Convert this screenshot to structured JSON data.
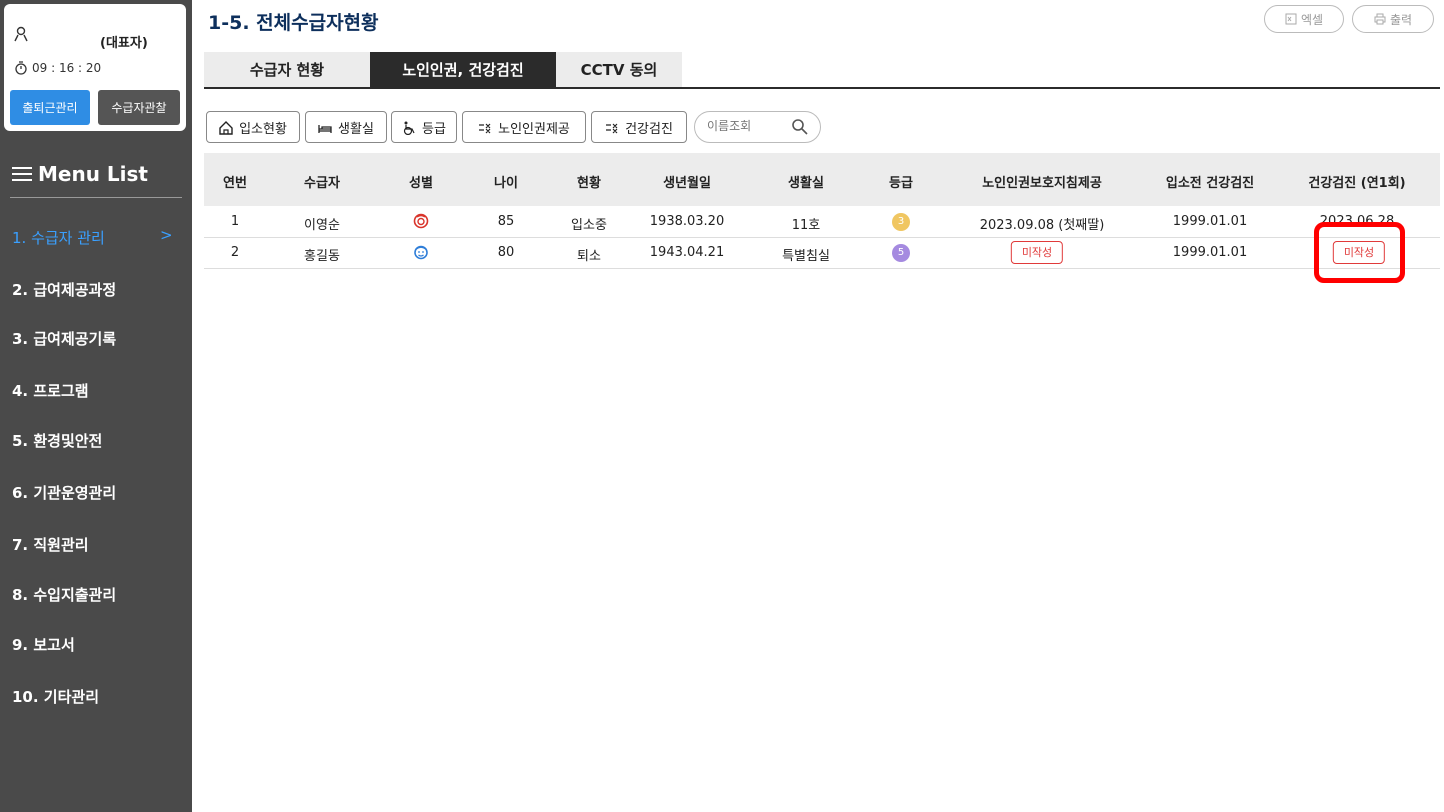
{
  "user": {
    "role": "(대표자)",
    "time": "09 : 16 : 20",
    "attend_btn": "출퇴근관리",
    "observe_btn": "수급자관찰"
  },
  "menu": {
    "title": "Menu List",
    "items": [
      {
        "label": "1. 수급자 관리",
        "chevron": ">"
      },
      {
        "label": "2. 급여제공과정"
      },
      {
        "label": "3. 급여제공기록"
      },
      {
        "label": "4. 프로그램"
      },
      {
        "label": "5. 환경및안전"
      },
      {
        "label": "6. 기관운영관리"
      },
      {
        "label": "7. 직원관리"
      },
      {
        "label": "8. 수입지출관리"
      },
      {
        "label": "9. 보고서"
      },
      {
        "label": "10. 기타관리"
      }
    ]
  },
  "header": {
    "title": "1-5. 전체수급자현황",
    "excel": "엑셀",
    "print": "출력"
  },
  "tabs": [
    {
      "label": "수급자 현황"
    },
    {
      "label": "노인인권, 건강검진"
    },
    {
      "label": "CCTV 동의"
    }
  ],
  "filters": [
    {
      "label": "입소현황",
      "icon": "home-icon"
    },
    {
      "label": "생활실",
      "icon": "bed-icon"
    },
    {
      "label": "등급",
      "icon": "wheelchair-icon"
    },
    {
      "label": "노인인권제공",
      "icon": "checklist-icon"
    },
    {
      "label": "건강검진",
      "icon": "checklist-icon"
    }
  ],
  "search": {
    "placeholder": "이름조회"
  },
  "table": {
    "headers": [
      "연번",
      "수급자",
      "성별",
      "나이",
      "현황",
      "생년월일",
      "생활실",
      "등급",
      "노인인권보호지침제공",
      "입소전 건강검진",
      "건강검진 (연1회)"
    ],
    "rows": [
      {
        "no": "1",
        "name": "이영순",
        "gender": "female",
        "age": "85",
        "status": "입소중",
        "birth": "1938.03.20",
        "room": "11호",
        "grade": "3",
        "grade_color": "#f0c661",
        "rights": "2023.09.08 (첫째딸)",
        "pre_check": "1999.01.01",
        "annual": "2023.06.28"
      },
      {
        "no": "2",
        "name": "홍길동",
        "gender": "male",
        "age": "80",
        "status": "퇴소",
        "birth": "1943.04.21",
        "room": "특별침실",
        "grade": "5",
        "grade_color": "#a58ae0",
        "rights_badge": "미작성",
        "pre_check": "1999.01.01",
        "annual_badge": "미작성"
      }
    ]
  },
  "colors": {
    "accent": "#2f8de4",
    "sidebar": "#4a4a4a",
    "title": "#0d2f5c",
    "warn": "#e03a3a"
  }
}
